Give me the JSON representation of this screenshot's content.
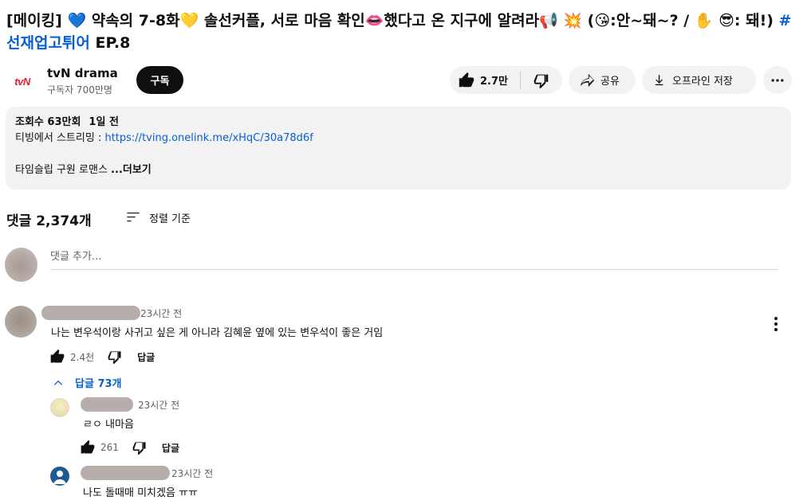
{
  "video": {
    "title_parts": [
      {
        "text": "[메이킹] ",
        "type": "text"
      },
      {
        "text": "💙",
        "type": "emoji"
      },
      {
        "text": " 약속의 7-8화",
        "type": "text"
      },
      {
        "text": "💛",
        "type": "emoji"
      },
      {
        "text": " 솔선커플, 서로 마음 확인",
        "type": "text"
      },
      {
        "text": "👄",
        "type": "emoji"
      },
      {
        "text": "했다고 온 지구에 알려라",
        "type": "text"
      },
      {
        "text": "📢",
        "type": "emoji"
      },
      {
        "text": " ",
        "type": "text"
      },
      {
        "text": "💥",
        "type": "emoji"
      },
      {
        "text": " (",
        "type": "text"
      },
      {
        "text": "😘",
        "type": "emoji"
      },
      {
        "text": ":안~돼~? / ",
        "type": "text"
      },
      {
        "text": "✋",
        "type": "emoji"
      },
      {
        "text": " ",
        "type": "text"
      },
      {
        "text": "😎",
        "type": "emoji"
      },
      {
        "text": ": 돼!) ",
        "type": "text"
      },
      {
        "text": "#선재업고튀어",
        "type": "hashtag"
      },
      {
        "text": " EP.8",
        "type": "text"
      }
    ]
  },
  "channel": {
    "logo_text": "tvN",
    "name": "tvN drama",
    "subscribers": "구독자 700만명",
    "subscribe_label": "구독"
  },
  "actions": {
    "like_count": "2.7만",
    "share_label": "공유",
    "offline_label": "오프라인 저장",
    "more_icon": "more-horizontal-icon"
  },
  "description": {
    "views": "조회수 63만회",
    "date": "1일 전",
    "stream_prefix": "티빙에서 스트리밍 : ",
    "stream_link": "https://tving.onelink.me/xHqC/30a78d6f",
    "preview": "타임슬립 구원 로맨스 ",
    "more_label": "...더보기"
  },
  "comments": {
    "count_label": "댓글 2,374개",
    "sort_label": "정렬 기준",
    "add_placeholder": "댓글 추가...",
    "items": [
      {
        "time": "23시간 전",
        "text": "나는 변우석이랑 사귀고 싶은 게 아니라 김혜윤 옆에 있는 변우석이 좋은 거임",
        "likes": "2.4천",
        "reply_label": "답글",
        "replies_toggle": "답글 73개"
      }
    ],
    "replies": [
      {
        "time": "23시간 전",
        "text": "ㄹㅇ 내마음",
        "likes": "261",
        "reply_label": "답글"
      },
      {
        "time": "23시간 전",
        "text": "나도 돌때매 미치겠음 ㅠㅠ"
      }
    ]
  },
  "colors": {
    "accent_link": "#065fd4",
    "brand_red": "#e0202b",
    "pill_bg": "#f2f2f2"
  }
}
